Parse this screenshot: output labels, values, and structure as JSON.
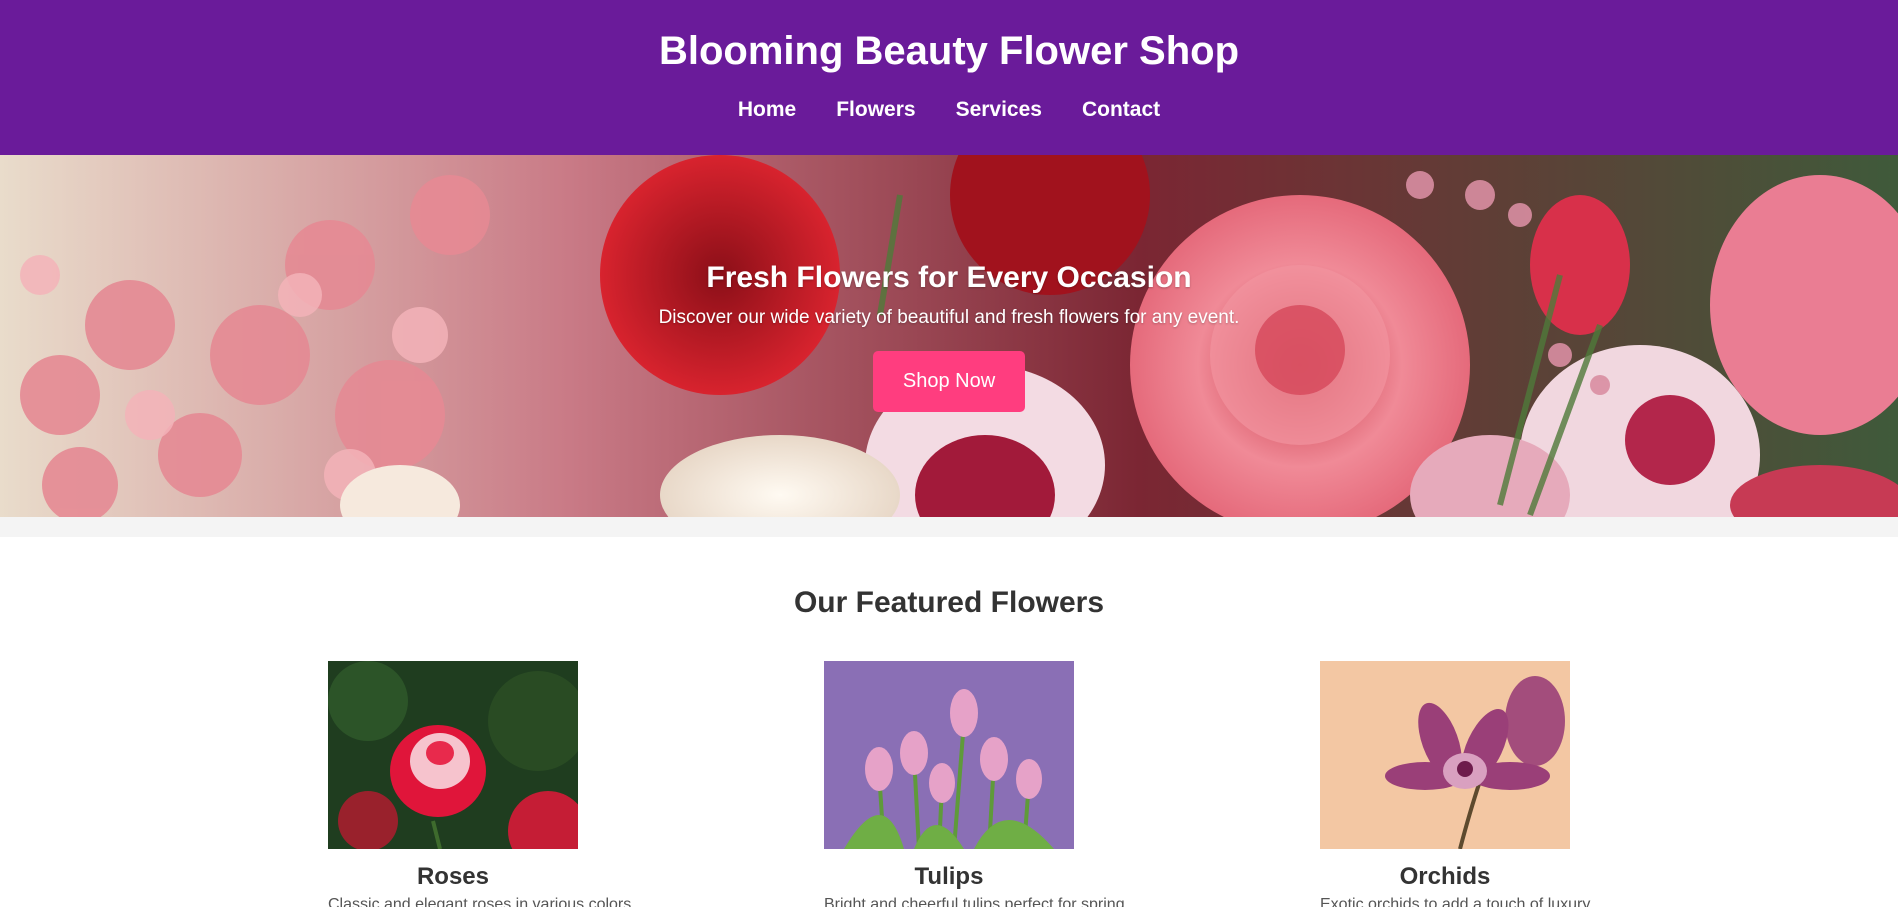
{
  "header": {
    "title": "Blooming Beauty Flower Shop",
    "nav": [
      "Home",
      "Flowers",
      "Services",
      "Contact"
    ]
  },
  "hero": {
    "title": "Fresh Flowers for Every Occasion",
    "subtitle": "Discover our wide variety of beautiful and fresh flowers for any event.",
    "button": "Shop Now"
  },
  "featured": {
    "title": "Our Featured Flowers",
    "cards": [
      {
        "name": "Roses",
        "desc": "Classic and elegant roses in various colors."
      },
      {
        "name": "Tulips",
        "desc": "Bright and cheerful tulips perfect for spring."
      },
      {
        "name": "Orchids",
        "desc": "Exotic orchids to add a touch of luxury."
      }
    ]
  },
  "colors": {
    "header_bg": "#6a1b9a",
    "button_bg": "#ff3d7f"
  }
}
